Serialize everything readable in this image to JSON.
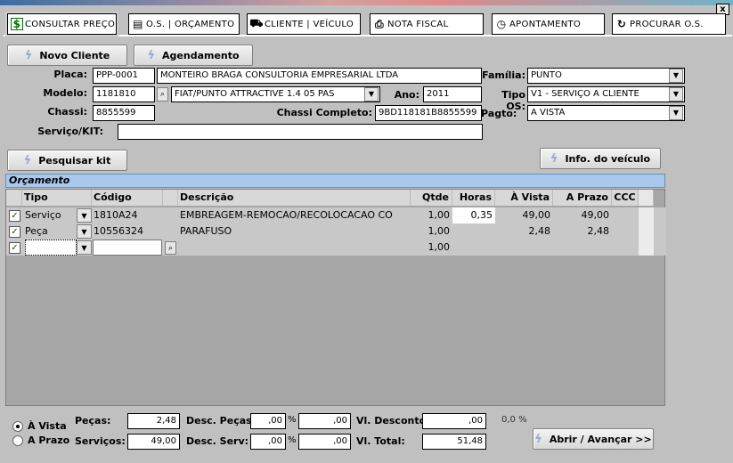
{
  "tabs": [
    {
      "label": "CONSULTAR PREÇO",
      "icon": "dollar-icon",
      "glyph": "$"
    },
    {
      "label": "O.S. | ORÇAMENTO",
      "icon": "document-icon",
      "glyph": "▤"
    },
    {
      "label": "CLIENTE | VEÍCULO",
      "icon": "car-icon",
      "glyph": "⛟"
    },
    {
      "label": "NOTA FISCAL",
      "icon": "printer-icon",
      "glyph": "⎙"
    },
    {
      "label": "APONTAMENTO",
      "icon": "clock-icon",
      "glyph": "◷"
    },
    {
      "label": "PROCURAR O.S.",
      "icon": "refresh-icon",
      "glyph": "↻"
    }
  ],
  "close_glyph": "x",
  "buttons": {
    "novo_cliente": "Novo Cliente",
    "agendamento": "Agendamento",
    "pesquisar_kit": "Pesquisar kit",
    "info_veiculo": "Info. do veículo",
    "abrir_avancar": "Abrir / Avançar >>"
  },
  "form": {
    "placa_label": "Placa:",
    "placa": "PPP-0001",
    "cliente": "MONTEIRO BRAGA CONSULTORIA EMPRESARIAL LTDA",
    "modelo_label": "Modelo:",
    "modelo": "1181810",
    "modelo_desc": "FIAT/PUNTO ATTRACTIVE 1.4   05 PAS",
    "ano_label": "Ano:",
    "ano": "2011",
    "chassi_label": "Chassi:",
    "chassi": "8855599",
    "chassi_completo_label": "Chassi Completo:",
    "chassi_completo": "9BD118181B8855599",
    "servico_kit_label": "Serviço/KIT:",
    "servico_kit": "",
    "familia_label": "Família:",
    "familia": "PUNTO",
    "tipo_os_label": "Tipo OS:",
    "tipo_os": "V1 - SERVIÇO A CLIENTE",
    "pagto_label": "Pagto:",
    "pagto": "A VISTA"
  },
  "orcamento": {
    "title": "Orçamento",
    "columns": [
      "Tipo",
      "Código",
      "Descrição",
      "Qtde",
      "Horas",
      "À Vista",
      "A Prazo",
      "CCC"
    ],
    "rows": [
      {
        "checked": true,
        "tipo": "Serviço",
        "codigo": "1810A24",
        "descricao": "EMBREAGEM-REMOCAO/RECOLOCACAO CO",
        "qtde": "1,00",
        "horas": "0,35",
        "avista": "49,00",
        "aprazo": "49,00"
      },
      {
        "checked": true,
        "tipo": "Peça",
        "codigo": "10556324",
        "descricao": "PARAFUSO",
        "qtde": "1,00",
        "horas": "",
        "avista": "2,48",
        "aprazo": "2,48"
      },
      {
        "checked": true,
        "tipo": "",
        "codigo": "",
        "descricao": "",
        "qtde": "1,00",
        "horas": "",
        "avista": "",
        "aprazo": ""
      }
    ]
  },
  "footer": {
    "avista_label": "À Vista",
    "aprazo_label": "A Prazo",
    "pecas_label": "Peças:",
    "pecas": "2,48",
    "servicos_label": "Serviços:",
    "servicos": "49,00",
    "desc_pecas_label": "Desc. Peças:",
    "desc_pecas_pct": ",00",
    "desc_pecas_val": ",00",
    "desc_serv_label": "Desc. Serv:",
    "desc_serv_pct": ",00",
    "desc_serv_val": ",00",
    "pct_symbol": "%",
    "vl_desconto_label": "Vl. Desconto:",
    "vl_desconto": ",00",
    "vl_desconto_pct": "0,0 %",
    "vl_total_label": "Vl. Total:",
    "vl_total": "51,48"
  }
}
